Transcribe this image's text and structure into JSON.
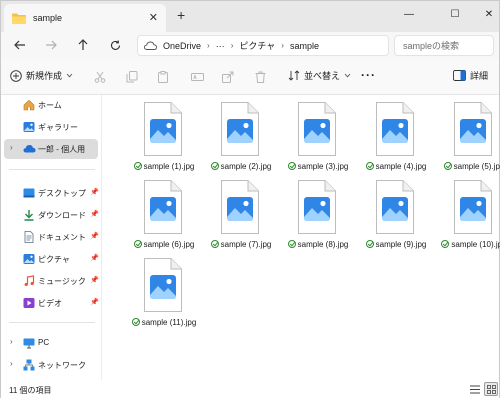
{
  "tab": {
    "title": "sample",
    "close": "✕",
    "new_tab": "+"
  },
  "window_controls": {
    "minimize": "—",
    "maximize": "☐",
    "close": "✕"
  },
  "address": {
    "crumbs": [
      "OneDrive",
      "···",
      "ピクチャ",
      "sample"
    ],
    "separator": "›",
    "search_placeholder": "sampleの検索"
  },
  "toolbar": {
    "new_label": "新規作成",
    "sort_label": "並べ替え",
    "more_label": "···",
    "details_label": "詳細"
  },
  "sidebar": {
    "top_items": [
      {
        "label": "ホーム",
        "icon": "home-icon"
      },
      {
        "label": "ギャラリー",
        "icon": "gallery-icon"
      },
      {
        "label": "一郎 - 個人用",
        "icon": "onedrive-icon"
      }
    ],
    "pinned_items": [
      {
        "label": "デスクトップ",
        "icon": "desktop-icon"
      },
      {
        "label": "ダウンロード",
        "icon": "download-icon"
      },
      {
        "label": "ドキュメント",
        "icon": "documents-icon"
      },
      {
        "label": "ピクチャ",
        "icon": "pictures-icon"
      },
      {
        "label": "ミュージック",
        "icon": "music-icon"
      },
      {
        "label": "ビデオ",
        "icon": "video-icon"
      }
    ],
    "bottom_items": [
      {
        "label": "PC",
        "icon": "pc-icon"
      },
      {
        "label": "ネットワーク",
        "icon": "network-icon"
      }
    ]
  },
  "files": [
    "sample (1).jpg",
    "sample (2).jpg",
    "sample (3).jpg",
    "sample (4).jpg",
    "sample (5).jpg",
    "sample (6).jpg",
    "sample (7).jpg",
    "sample (8).jpg",
    "sample (9).jpg",
    "sample (10).jpg",
    "sample (11).jpg"
  ],
  "status": {
    "item_count": "11 個の項目"
  },
  "colors": {
    "accent": "#1f6fd6",
    "selected_bg": "#dcdcdc",
    "sync_ok": "#2e8b2e"
  }
}
